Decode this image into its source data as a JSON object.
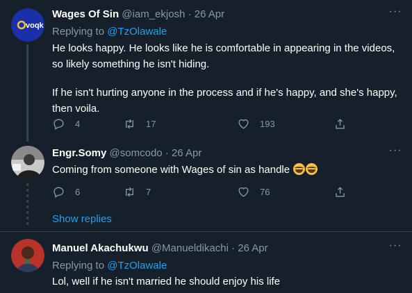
{
  "tweets": [
    {
      "name": "Wages Of Sin",
      "handle": "@iam_ekjosh",
      "separator": "·",
      "date": "26 Apr",
      "replying_prefix": "Replying to",
      "replying_to": "@TzOlawale",
      "text_p1_l1": "He looks happy. He looks like he is comfortable in appearing in the videos,",
      "text_p1_l2": "so likely something he isn't hiding.",
      "text_p2_l1": "If he isn't hurting anyone in the process and if he's happy, and she's happy,",
      "text_p2_l2": "then voila.",
      "replies": "4",
      "retweets": "17",
      "likes": "193",
      "avatar_text": "voqk"
    },
    {
      "name": "Engr.Somy",
      "handle": "@somcodo",
      "separator": "·",
      "date": "26 Apr",
      "text": "Coming from someone with Wages of sin as handle",
      "replies": "6",
      "retweets": "7",
      "likes": "76"
    },
    {
      "name": "Manuel Akachukwu",
      "handle": "@Manueldikachi",
      "separator": "·",
      "date": "26 Apr",
      "replying_prefix": "Replying to",
      "replying_to": "@TzOlawale",
      "text": "Lol, well if he isn't married he should enjoy his life"
    }
  ],
  "show_replies": "Show replies",
  "more_glyph": "···",
  "colors": {
    "background": "#15202b",
    "accent": "#1da1f2",
    "muted": "#8899a6",
    "divider": "#38444d"
  },
  "icons": [
    "reply-icon",
    "retweet-icon",
    "like-icon",
    "share-icon",
    "more-icon",
    "rofl-emoji-icon"
  ]
}
